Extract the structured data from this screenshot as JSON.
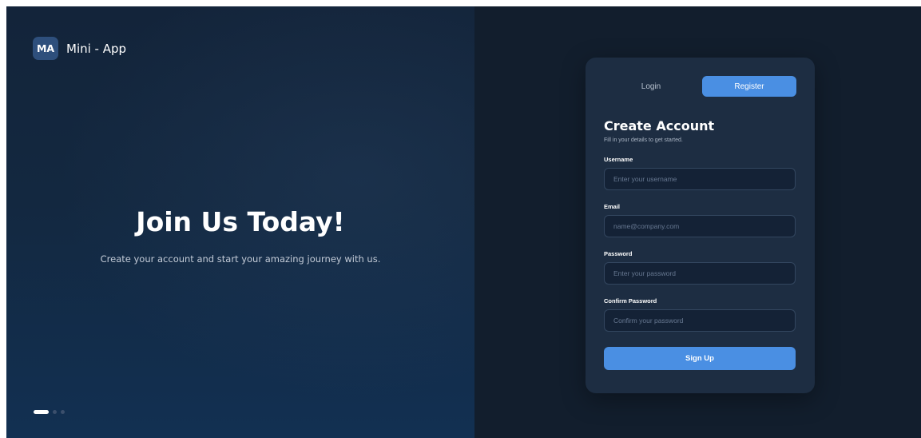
{
  "brand": {
    "logo_text": "MA",
    "name": "Mini - App"
  },
  "hero": {
    "title": "Join Us Today!",
    "subtitle": "Create your account and start your amazing journey with us.",
    "carousel": {
      "total": 3,
      "active_index": 0
    }
  },
  "auth": {
    "tabs": [
      {
        "label": "Login",
        "active": false
      },
      {
        "label": "Register",
        "active": true
      }
    ],
    "title": "Create Account",
    "subtitle": "Fill in your details to get started.",
    "fields": {
      "username": {
        "label": "Username",
        "value": "",
        "placeholder": "Enter your username"
      },
      "email": {
        "label": "Email",
        "value": "",
        "placeholder": "name@company.com"
      },
      "password": {
        "label": "Password",
        "value": "",
        "placeholder": "Enter your password"
      },
      "confirm_password": {
        "label": "Confirm Password",
        "value": "",
        "placeholder": "Confirm your password"
      }
    },
    "submit_label": "Sign Up"
  },
  "colors": {
    "accent": "#4a8fe3",
    "card_background": "#1d2d42",
    "right_background": "#121e2d",
    "input_background": "#142236"
  }
}
